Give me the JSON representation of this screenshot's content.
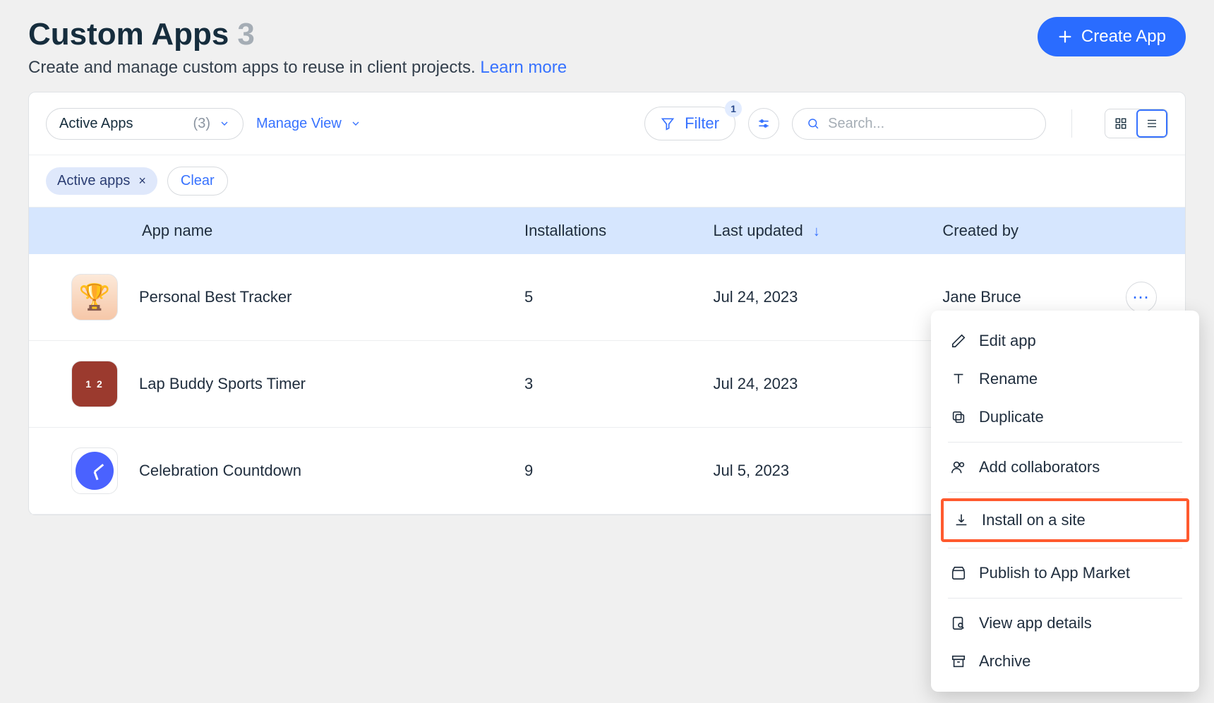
{
  "header": {
    "title": "Custom Apps",
    "count": "3",
    "subtitle": "Create and manage custom apps to reuse in client projects.",
    "learn_more": "Learn more",
    "create_label": "Create App"
  },
  "toolbar": {
    "view_select": {
      "label": "Active Apps",
      "count": "(3)"
    },
    "manage_view": "Manage View",
    "filter": {
      "label": "Filter",
      "badge": "1"
    },
    "search_placeholder": "Search..."
  },
  "chips": {
    "active_label": "Active apps",
    "clear": "Clear"
  },
  "columns": {
    "name": "App name",
    "installations": "Installations",
    "updated": "Last updated",
    "created_by": "Created by"
  },
  "rows": [
    {
      "name": "Personal Best Tracker",
      "installations": "5",
      "updated": "Jul 24, 2023",
      "created_by": "Jane Bruce",
      "icon": "trophy"
    },
    {
      "name": "Lap Buddy Sports Timer",
      "installations": "3",
      "updated": "Jul 24, 2023",
      "created_by": "",
      "icon": "track"
    },
    {
      "name": "Celebration Countdown",
      "installations": "9",
      "updated": "Jul 5, 2023",
      "created_by": "",
      "icon": "clock"
    }
  ],
  "menu": {
    "edit": "Edit app",
    "rename": "Rename",
    "duplicate": "Duplicate",
    "add_collab": "Add collaborators",
    "install": "Install on a site",
    "publish": "Publish to App Market",
    "details": "View app details",
    "archive": "Archive"
  }
}
